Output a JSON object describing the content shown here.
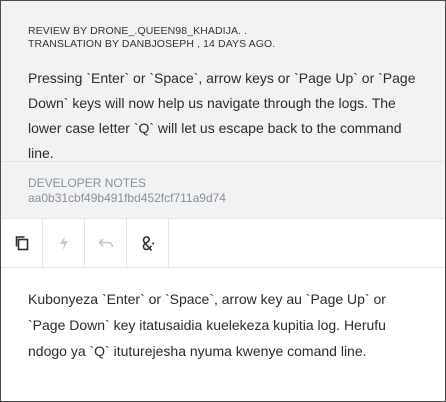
{
  "review": {
    "line1": "REVIEW BY DRONE_.QUEEN98_KHADIJA. .",
    "line2": "TRANSLATION BY DANBJOSEPH , 14 DAYS AGO.",
    "source_text": "Pressing `Enter` or `Space`, arrow keys or `Page Up` or `Page Down` keys will now help us navigate through the logs. The lower case letter `Q` will let us escape back to the command line."
  },
  "notes": {
    "label": "DEVELOPER NOTES",
    "hash": "aa0b31cbf49b491fbd452fcf711a9d74"
  },
  "toolbar": {
    "icons": [
      "copy-icon",
      "lightning-icon",
      "undo-icon",
      "special-chars-icon"
    ]
  },
  "translation": {
    "text": "Kubonyeza `Enter` or `Space`, arrow key au `Page Up` or `Page Down` key itatusaidia kuelekeza kupitia log. Herufu ndogo ya `Q` ituturejesha nyuma kwenye comand line."
  }
}
